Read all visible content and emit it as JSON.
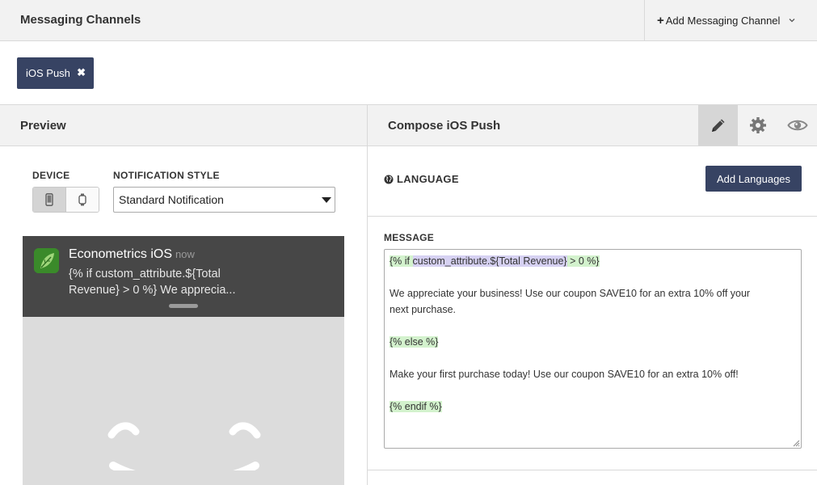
{
  "header": {
    "title": "Messaging Channels",
    "add_channel_label": "Add Messaging Channel"
  },
  "chips": [
    {
      "label": "iOS Push"
    }
  ],
  "preview": {
    "title": "Preview",
    "device_label": "DEVICE",
    "notification_style_label": "NOTIFICATION STYLE",
    "notification_style_value": "Standard Notification",
    "notification": {
      "app_name": "Econometrics iOS",
      "time": "now",
      "body": "{% if custom_attribute.${Total Revenue} > 0 %} We apprecia..."
    }
  },
  "compose": {
    "title": "Compose iOS Push",
    "language_label": "LANGUAGE",
    "add_languages_label": "Add Languages",
    "message_label": "MESSAGE",
    "message": {
      "line1_pre": "{% if ",
      "line1_var": "custom_attribute.${Total Revenue}",
      "line1_post": " > 0 %}",
      "line2": "We appreciate your business! Use our coupon SAVE10 for an extra 10% off your",
      "line3": "next purchase.",
      "line4": "{% else %}",
      "line5": "Make your first purchase today! Use our coupon SAVE10 for an extra 10% off!",
      "line6": "{% endif %}"
    }
  },
  "icons": [
    "plus-icon",
    "chevron-down-icon",
    "close-icon",
    "phone-icon",
    "watch-icon",
    "dropdown-triangle-icon",
    "globe-icon",
    "pencil-icon",
    "gear-icon",
    "eye-icon",
    "app-leaf-icon",
    "resize-handle-icon"
  ],
  "colors": {
    "navy": "#374363",
    "liquid_highlight": "#d3f2cd",
    "variable_highlight": "#d6d1f2",
    "notification_bg": "#474747"
  }
}
